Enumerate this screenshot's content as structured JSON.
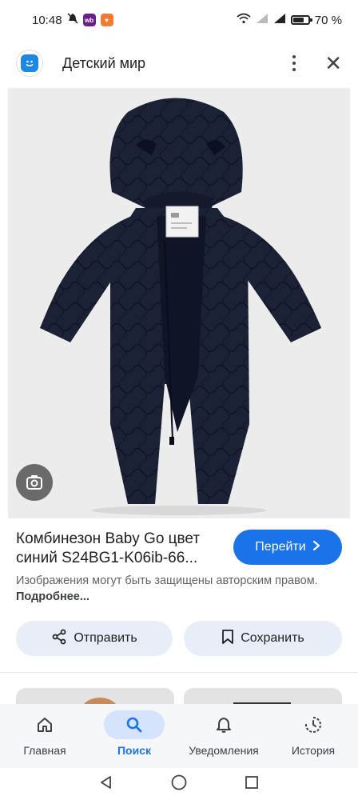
{
  "status_bar": {
    "time": "10:48",
    "wb_badge": "wb",
    "battery_percent": "70 %"
  },
  "header": {
    "site_name": "Детский мир",
    "logo_icon": "detsky-mir-logo-icon"
  },
  "product": {
    "title": "Комбинезон Baby Go цвет синий S24BG1-K06ib-66...",
    "go_button_label": "Перейти",
    "copyright_note": "Изображения могут быть защищены авторским правом.",
    "more_link": "Подробнее..."
  },
  "actions": {
    "share_label": "Отправить",
    "save_label": "Сохранить"
  },
  "bottom_nav": {
    "items": [
      {
        "label": "Главная",
        "icon": "home-icon"
      },
      {
        "label": "Поиск",
        "icon": "search-icon"
      },
      {
        "label": "Уведомления",
        "icon": "bell-icon"
      },
      {
        "label": "История",
        "icon": "history-icon"
      }
    ],
    "active_index": 1
  },
  "colors": {
    "accent": "#1a73e8",
    "chip_bg": "#e8eef8",
    "suit_color": "#1b2236"
  }
}
